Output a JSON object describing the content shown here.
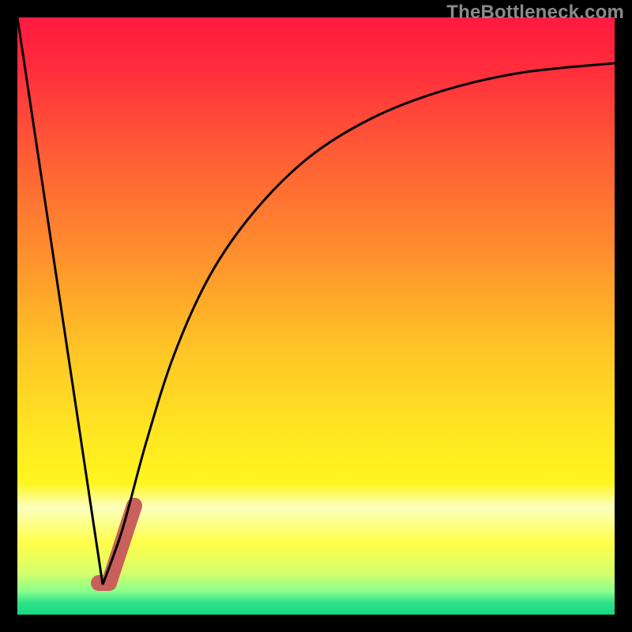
{
  "watermark": "TheBottleneck.com",
  "chart_data": {
    "type": "line",
    "title": "",
    "xlabel": "",
    "ylabel": "",
    "xlim": [
      22,
      778
    ],
    "ylim": [
      22,
      778
    ],
    "grid": false,
    "legend": false,
    "gradient_stops": [
      {
        "pct": 0,
        "color": "#ff1a3f"
      },
      {
        "pct": 8,
        "color": "#ff2b3c"
      },
      {
        "pct": 22,
        "color": "#ff5a36"
      },
      {
        "pct": 38,
        "color": "#ff8a2e"
      },
      {
        "pct": 55,
        "color": "#ffc326"
      },
      {
        "pct": 70,
        "color": "#ffe722"
      },
      {
        "pct": 78,
        "color": "#fff61f"
      },
      {
        "pct": 82,
        "color": "#fbffbf"
      },
      {
        "pct": 88,
        "color": "#ffff4a"
      },
      {
        "pct": 93,
        "color": "#d6ff6a"
      },
      {
        "pct": 96,
        "color": "#8dff8d"
      },
      {
        "pct": 98,
        "color": "#30e28a"
      },
      {
        "pct": 100,
        "color": "#14d980"
      }
    ],
    "series": [
      {
        "name": "left-descent",
        "stroke": "#000000",
        "stroke_width": 3,
        "points": [
          {
            "x": 22,
            "y": 22
          },
          {
            "x": 130,
            "y": 740
          }
        ]
      },
      {
        "name": "right-curve",
        "stroke": "#000000",
        "stroke_width": 3,
        "points": [
          {
            "x": 130,
            "y": 740
          },
          {
            "x": 155,
            "y": 670
          },
          {
            "x": 185,
            "y": 560
          },
          {
            "x": 220,
            "y": 450
          },
          {
            "x": 265,
            "y": 350
          },
          {
            "x": 320,
            "y": 270
          },
          {
            "x": 390,
            "y": 200
          },
          {
            "x": 470,
            "y": 150
          },
          {
            "x": 560,
            "y": 115
          },
          {
            "x": 660,
            "y": 92
          },
          {
            "x": 778,
            "y": 80
          }
        ]
      },
      {
        "name": "marker-stroke",
        "stroke": "#c9605b",
        "stroke_width": 20,
        "linecap": "round",
        "points": [
          {
            "x": 125,
            "y": 738
          },
          {
            "x": 138,
            "y": 738
          },
          {
            "x": 170,
            "y": 640
          }
        ]
      }
    ]
  }
}
